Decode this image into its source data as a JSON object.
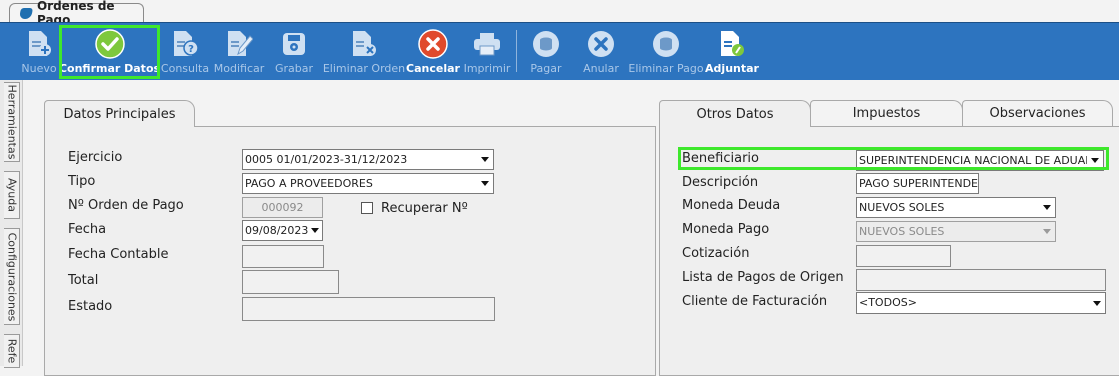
{
  "window_tab": {
    "title": "Ordenes de Pago"
  },
  "toolbar": {
    "buttons": [
      {
        "label": "Nuevo",
        "icon": "new-document-icon",
        "enabled": false
      },
      {
        "label": "Confirmar Datos",
        "icon": "check-circle-icon",
        "enabled": true
      },
      {
        "label": "Consulta",
        "icon": "query-document-icon",
        "enabled": false
      },
      {
        "label": "Modificar",
        "icon": "edit-document-icon",
        "enabled": false
      },
      {
        "label": "Grabar",
        "icon": "save-icon",
        "enabled": false
      },
      {
        "label": "Eliminar Orden",
        "icon": "delete-document-icon",
        "enabled": false
      },
      {
        "label": "Cancelar",
        "icon": "cancel-circle-icon",
        "enabled": true
      },
      {
        "label": "Imprimir",
        "icon": "printer-icon",
        "enabled": false
      },
      {
        "label": "Pagar",
        "icon": "pay-coins-icon",
        "enabled": false
      },
      {
        "label": "Anular",
        "icon": "void-x-icon",
        "enabled": false
      },
      {
        "label": "Eliminar Pago",
        "icon": "delete-payment-icon",
        "enabled": false
      },
      {
        "label": "Adjuntar",
        "icon": "attach-document-icon",
        "enabled": true
      }
    ]
  },
  "side_tabs": [
    "Herramientas",
    "Ayuda",
    "Configuraciones",
    "Refe"
  ],
  "left_panel": {
    "tab": "Datos Principales",
    "fields": {
      "ejercicio": {
        "label": "Ejercicio",
        "value": "0005 01/01/2023-31/12/2023"
      },
      "tipo": {
        "label": "Tipo",
        "value": "PAGO A PROVEEDORES"
      },
      "orden": {
        "label": "Nº Orden de Pago",
        "value": "000092"
      },
      "recuperar": {
        "label": "Recuperar Nº",
        "checked": false
      },
      "fecha": {
        "label": "Fecha",
        "value": "09/08/2023"
      },
      "fecha_contable": {
        "label": "Fecha Contable",
        "value": ""
      },
      "total": {
        "label": "Total",
        "value": ""
      },
      "estado": {
        "label": "Estado",
        "value": ""
      }
    }
  },
  "right_panel": {
    "tabs": [
      "Otros Datos",
      "Impuestos",
      "Observaciones"
    ],
    "fields": {
      "beneficiario": {
        "label": "Beneficiario",
        "value": "SUPERINTENDENCIA NACIONAL DE ADUANAS Y DE"
      },
      "descripcion": {
        "label": "Descripción",
        "value": "PAGO SUPERINTENDENCI"
      },
      "moneda_deuda": {
        "label": "Moneda Deuda",
        "value": "NUEVOS SOLES"
      },
      "moneda_pago": {
        "label": "Moneda Pago",
        "value": "NUEVOS SOLES"
      },
      "cotizacion": {
        "label": "Cotización",
        "value": ""
      },
      "lista_pagos": {
        "label": "Lista de Pagos de Origen",
        "value": ""
      },
      "cliente": {
        "label": "Cliente de Facturación",
        "value": "<TODOS>"
      }
    }
  },
  "colors": {
    "toolbar": "#2d74bf",
    "highlight": "#3ee82c",
    "confirm": "#7ec83c",
    "cancel": "#e04a2c"
  }
}
